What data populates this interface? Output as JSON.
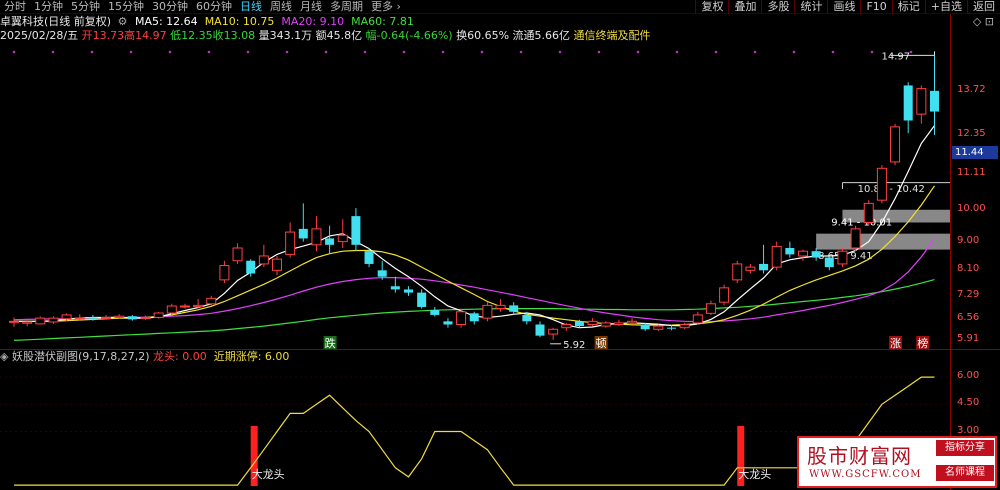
{
  "periods": [
    {
      "label": "分时",
      "active": false
    },
    {
      "label": "1分钟",
      "active": false
    },
    {
      "label": "5分钟",
      "active": false
    },
    {
      "label": "15分钟",
      "active": false
    },
    {
      "label": "30分钟",
      "active": false
    },
    {
      "label": "60分钟",
      "active": false
    },
    {
      "label": "日线",
      "active": true
    },
    {
      "label": "周线",
      "active": false
    },
    {
      "label": "月线",
      "active": false
    },
    {
      "label": "多周期",
      "active": false
    },
    {
      "label": "更多 ›",
      "active": false
    }
  ],
  "tools": [
    "复权",
    "叠加",
    "多股",
    "统计",
    "画线",
    "F10",
    "标记",
    "+自选",
    "返回"
  ],
  "stock": {
    "name": "卓翼科技(日线 前复权)",
    "ma5": "MA5: 12.64",
    "ma10": "MA10: 10.75",
    "ma20": "MA20: 9.10",
    "ma60": "MA60: 7.81",
    "control_icons": "◇ ⊡"
  },
  "quote": {
    "date": "2025/02/28/五",
    "open": "开13.73",
    "high": "高14.97",
    "low": "低12.35",
    "close": "收13.08",
    "volume": "量343.1万",
    "amount": "额45.8亿",
    "change": "幅-0.64(-4.66%)",
    "turnover": "换60.65%",
    "float_cap": "流通5.66亿",
    "concept": "通信终端及配件"
  },
  "axis": {
    "main_ticks": [
      "13.72",
      "12.35",
      "11.11",
      "10.00",
      "9.00",
      "8.10",
      "7.29",
      "6.56",
      "5.91"
    ],
    "sub_ticks": [
      "6.00",
      "4.50",
      "3.00"
    ],
    "current_price": "11.44"
  },
  "annotations": {
    "high_label": "14.97",
    "low_label": "5.92",
    "die": "跌",
    "dun": "顿",
    "zhang": "涨",
    "bang": "榜",
    "zone1": "10.85 - 10.42",
    "zone2": "9.41 - 10.01",
    "zone3": "8.65 - 9.41"
  },
  "sub_indicator": {
    "name": "妖股潜伏副图(9,17,8,27,2)",
    "longtou": "龙头: 0.00",
    "recent": "近期涨停: 6.00",
    "dalongtou": "大龙头"
  },
  "watermark": {
    "title": "股市财富网",
    "url": "WWW.GSCFW.COM",
    "tag1": "指标分享",
    "tag2": "名师课程"
  },
  "colors": {
    "up": "#ff4040",
    "down": "#40e0f0",
    "ma5": "#ffffff",
    "ma10": "#f3e22a",
    "ma20": "#e040fb",
    "ma60": "#3fe03f",
    "signal": "#ff2020",
    "sub_line": "#f0dc40",
    "active": "#3ad6ff"
  },
  "chart_data": {
    "type": "candlestick",
    "price_range": [
      5.6,
      15.2
    ],
    "candles": [
      {
        "o": 6.48,
        "h": 6.62,
        "l": 6.33,
        "c": 6.5
      },
      {
        "o": 6.44,
        "h": 6.54,
        "l": 6.35,
        "c": 6.48
      },
      {
        "o": 6.42,
        "h": 6.65,
        "l": 6.4,
        "c": 6.6
      },
      {
        "o": 6.48,
        "h": 6.66,
        "l": 6.42,
        "c": 6.6
      },
      {
        "o": 6.58,
        "h": 6.75,
        "l": 6.5,
        "c": 6.7
      },
      {
        "o": 6.58,
        "h": 6.72,
        "l": 6.52,
        "c": 6.6
      },
      {
        "o": 6.62,
        "h": 6.7,
        "l": 6.52,
        "c": 6.58
      },
      {
        "o": 6.6,
        "h": 6.7,
        "l": 6.55,
        "c": 6.62
      },
      {
        "o": 6.62,
        "h": 6.72,
        "l": 6.58,
        "c": 6.66
      },
      {
        "o": 6.66,
        "h": 6.7,
        "l": 6.52,
        "c": 6.56
      },
      {
        "o": 6.6,
        "h": 6.68,
        "l": 6.55,
        "c": 6.62
      },
      {
        "o": 6.62,
        "h": 6.8,
        "l": 6.58,
        "c": 6.76
      },
      {
        "o": 6.76,
        "h": 7.05,
        "l": 6.7,
        "c": 6.98
      },
      {
        "o": 6.95,
        "h": 7.05,
        "l": 6.9,
        "c": 6.98
      },
      {
        "o": 6.96,
        "h": 7.2,
        "l": 6.92,
        "c": 7.0
      },
      {
        "o": 7.05,
        "h": 7.3,
        "l": 7.0,
        "c": 7.22
      },
      {
        "o": 7.8,
        "h": 8.4,
        "l": 7.7,
        "c": 8.25
      },
      {
        "o": 8.4,
        "h": 8.95,
        "l": 8.3,
        "c": 8.8
      },
      {
        "o": 8.4,
        "h": 8.45,
        "l": 7.9,
        "c": 8.0
      },
      {
        "o": 8.3,
        "h": 8.9,
        "l": 8.2,
        "c": 8.55
      },
      {
        "o": 8.1,
        "h": 8.55,
        "l": 7.95,
        "c": 8.45
      },
      {
        "o": 8.6,
        "h": 9.6,
        "l": 8.5,
        "c": 9.3
      },
      {
        "o": 9.4,
        "h": 10.2,
        "l": 9.0,
        "c": 9.1
      },
      {
        "o": 8.9,
        "h": 9.8,
        "l": 8.7,
        "c": 9.4
      },
      {
        "o": 9.1,
        "h": 9.5,
        "l": 8.6,
        "c": 8.9
      },
      {
        "o": 9.0,
        "h": 9.7,
        "l": 8.8,
        "c": 9.2
      },
      {
        "o": 9.8,
        "h": 10.05,
        "l": 8.7,
        "c": 8.9
      },
      {
        "o": 8.7,
        "h": 8.8,
        "l": 8.2,
        "c": 8.3
      },
      {
        "o": 8.1,
        "h": 8.4,
        "l": 7.8,
        "c": 7.9
      },
      {
        "o": 7.6,
        "h": 7.9,
        "l": 7.4,
        "c": 7.5
      },
      {
        "o": 7.5,
        "h": 7.6,
        "l": 7.3,
        "c": 7.4
      },
      {
        "o": 7.4,
        "h": 7.5,
        "l": 6.9,
        "c": 6.95
      },
      {
        "o": 6.85,
        "h": 6.95,
        "l": 6.65,
        "c": 6.7
      },
      {
        "o": 6.5,
        "h": 6.6,
        "l": 6.3,
        "c": 6.4
      },
      {
        "o": 6.4,
        "h": 6.9,
        "l": 6.3,
        "c": 6.8
      },
      {
        "o": 6.75,
        "h": 6.8,
        "l": 6.4,
        "c": 6.5
      },
      {
        "o": 6.6,
        "h": 7.1,
        "l": 6.5,
        "c": 7.0
      },
      {
        "o": 6.9,
        "h": 7.2,
        "l": 6.8,
        "c": 7.0
      },
      {
        "o": 7.0,
        "h": 7.1,
        "l": 6.7,
        "c": 6.8
      },
      {
        "o": 6.7,
        "h": 6.8,
        "l": 6.4,
        "c": 6.5
      },
      {
        "o": 6.4,
        "h": 6.5,
        "l": 6.0,
        "c": 6.05
      },
      {
        "o": 6.1,
        "h": 6.3,
        "l": 5.92,
        "c": 6.25
      },
      {
        "o": 6.3,
        "h": 6.45,
        "l": 6.2,
        "c": 6.4
      },
      {
        "o": 6.5,
        "h": 6.55,
        "l": 6.3,
        "c": 6.35
      },
      {
        "o": 6.4,
        "h": 6.6,
        "l": 6.35,
        "c": 6.5
      },
      {
        "o": 6.35,
        "h": 6.5,
        "l": 6.3,
        "c": 6.45
      },
      {
        "o": 6.4,
        "h": 6.55,
        "l": 6.35,
        "c": 6.45
      },
      {
        "o": 6.45,
        "h": 6.6,
        "l": 6.4,
        "c": 6.5
      },
      {
        "o": 6.4,
        "h": 6.45,
        "l": 6.2,
        "c": 6.25
      },
      {
        "o": 6.25,
        "h": 6.4,
        "l": 6.2,
        "c": 6.35
      },
      {
        "o": 6.3,
        "h": 6.4,
        "l": 6.22,
        "c": 6.28
      },
      {
        "o": 6.3,
        "h": 6.45,
        "l": 6.25,
        "c": 6.4
      },
      {
        "o": 6.45,
        "h": 6.8,
        "l": 6.4,
        "c": 6.7
      },
      {
        "o": 6.75,
        "h": 7.15,
        "l": 6.7,
        "c": 7.05
      },
      {
        "o": 7.1,
        "h": 7.65,
        "l": 7.0,
        "c": 7.55
      },
      {
        "o": 7.8,
        "h": 8.4,
        "l": 7.7,
        "c": 8.3
      },
      {
        "o": 8.1,
        "h": 8.3,
        "l": 8.0,
        "c": 8.2
      },
      {
        "o": 8.3,
        "h": 8.9,
        "l": 8.0,
        "c": 8.1
      },
      {
        "o": 8.2,
        "h": 9.0,
        "l": 8.1,
        "c": 8.85
      },
      {
        "o": 8.8,
        "h": 9.0,
        "l": 8.5,
        "c": 8.6
      },
      {
        "o": 8.55,
        "h": 8.75,
        "l": 8.4,
        "c": 8.7
      },
      {
        "o": 8.7,
        "h": 8.8,
        "l": 8.4,
        "c": 8.5
      },
      {
        "o": 8.5,
        "h": 8.55,
        "l": 8.1,
        "c": 8.2
      },
      {
        "o": 8.3,
        "h": 8.8,
        "l": 8.2,
        "c": 8.7
      },
      {
        "o": 8.8,
        "h": 9.5,
        "l": 8.7,
        "c": 9.4
      },
      {
        "o": 9.6,
        "h": 10.3,
        "l": 9.5,
        "c": 10.2
      },
      {
        "o": 10.3,
        "h": 11.4,
        "l": 10.2,
        "c": 11.3
      },
      {
        "o": 11.5,
        "h": 12.7,
        "l": 11.4,
        "c": 12.6
      },
      {
        "o": 13.9,
        "h": 14.0,
        "l": 12.4,
        "c": 12.8
      },
      {
        "o": 13.0,
        "h": 13.9,
        "l": 12.7,
        "c": 13.8
      },
      {
        "o": 13.73,
        "h": 14.97,
        "l": 12.35,
        "c": 13.08
      }
    ],
    "ma5": [
      6.5,
      6.5,
      6.5,
      6.52,
      6.56,
      6.6,
      6.62,
      6.62,
      6.63,
      6.6,
      6.6,
      6.64,
      6.74,
      6.84,
      6.93,
      7.05,
      7.38,
      7.78,
      8.04,
      8.35,
      8.6,
      8.75,
      8.86,
      8.98,
      9.18,
      9.25,
      9.0,
      8.78,
      8.46,
      8.16,
      7.9,
      7.6,
      7.27,
      6.98,
      6.83,
      6.66,
      6.62,
      6.66,
      6.72,
      6.76,
      6.7,
      6.55,
      6.38,
      6.3,
      6.32,
      6.4,
      6.43,
      6.45,
      6.43,
      6.41,
      6.37,
      6.36,
      6.42,
      6.56,
      6.8,
      7.17,
      7.52,
      7.86,
      8.3,
      8.43,
      8.5,
      8.55,
      8.55,
      8.57,
      8.72,
      9.0,
      9.6,
      10.35,
      11.2,
      12.08,
      12.64
    ],
    "ma10": [
      6.5,
      6.5,
      6.5,
      6.5,
      6.52,
      6.54,
      6.56,
      6.58,
      6.6,
      6.6,
      6.62,
      6.65,
      6.7,
      6.78,
      6.86,
      6.97,
      7.12,
      7.3,
      7.48,
      7.66,
      7.86,
      8.08,
      8.3,
      8.5,
      8.62,
      8.7,
      8.72,
      8.72,
      8.68,
      8.58,
      8.42,
      8.2,
      7.98,
      7.76,
      7.55,
      7.34,
      7.12,
      6.96,
      6.82,
      6.72,
      6.66,
      6.6,
      6.55,
      6.5,
      6.46,
      6.43,
      6.41,
      6.39,
      6.38,
      6.38,
      6.38,
      6.4,
      6.42,
      6.47,
      6.55,
      6.69,
      6.85,
      7.04,
      7.26,
      7.47,
      7.64,
      7.8,
      7.94,
      8.08,
      8.24,
      8.45,
      8.76,
      9.16,
      9.62,
      10.15,
      10.75
    ],
    "ma20": [
      6.55,
      6.56,
      6.57,
      6.58,
      6.58,
      6.6,
      6.6,
      6.61,
      6.62,
      6.63,
      6.63,
      6.64,
      6.66,
      6.68,
      6.71,
      6.75,
      6.82,
      6.9,
      6.99,
      7.09,
      7.2,
      7.32,
      7.45,
      7.57,
      7.67,
      7.75,
      7.81,
      7.85,
      7.87,
      7.87,
      7.85,
      7.82,
      7.77,
      7.71,
      7.64,
      7.57,
      7.49,
      7.41,
      7.33,
      7.24,
      7.16,
      7.07,
      6.99,
      6.91,
      6.83,
      6.76,
      6.7,
      6.64,
      6.59,
      6.55,
      6.52,
      6.5,
      6.49,
      6.49,
      6.51,
      6.54,
      6.58,
      6.63,
      6.7,
      6.77,
      6.84,
      6.92,
      7.0,
      7.09,
      7.19,
      7.3,
      7.45,
      7.7,
      8.05,
      8.52,
      9.1
    ],
    "ma60": [
      5.9,
      5.92,
      5.94,
      5.96,
      5.98,
      6.0,
      6.02,
      6.04,
      6.06,
      6.08,
      6.1,
      6.12,
      6.14,
      6.16,
      6.18,
      6.2,
      6.23,
      6.27,
      6.31,
      6.35,
      6.4,
      6.45,
      6.5,
      6.56,
      6.61,
      6.65,
      6.69,
      6.73,
      6.76,
      6.79,
      6.81,
      6.83,
      6.85,
      6.86,
      6.87,
      6.88,
      6.89,
      6.9,
      6.9,
      6.9,
      6.9,
      6.9,
      6.89,
      6.88,
      6.88,
      6.87,
      6.87,
      6.86,
      6.86,
      6.86,
      6.86,
      6.87,
      6.88,
      6.9,
      6.92,
      6.94,
      6.97,
      7.0,
      7.04,
      7.08,
      7.12,
      7.16,
      7.2,
      7.25,
      7.3,
      7.36,
      7.43,
      7.51,
      7.6,
      7.7,
      7.81
    ],
    "sub_range": [
      0,
      6.5
    ],
    "sub_line": [
      0.05,
      0.05,
      0.05,
      0.05,
      0.05,
      0.05,
      0.05,
      0.05,
      0.05,
      0.05,
      0.05,
      0.05,
      0.05,
      0.05,
      0.05,
      0.05,
      0.05,
      0.05,
      1.0,
      2.0,
      3.0,
      4.0,
      4.0,
      4.5,
      5.0,
      4.3,
      3.6,
      3.0,
      2.0,
      1.0,
      0.5,
      1.5,
      3.0,
      3.0,
      3.0,
      2.5,
      2.0,
      1.0,
      0.05,
      0.05,
      0.05,
      0.05,
      0.05,
      0.05,
      0.05,
      0.05,
      0.05,
      0.05,
      0.05,
      0.05,
      0.05,
      0.05,
      0.05,
      0.05,
      0.05,
      1.0,
      1.0,
      1.0,
      1.0,
      1.0,
      1.0,
      1.0,
      1.0,
      1.5,
      2.5,
      3.5,
      4.5,
      5.0,
      5.5,
      6.0,
      6.0
    ],
    "signal_bars": [
      18,
      55
    ]
  }
}
